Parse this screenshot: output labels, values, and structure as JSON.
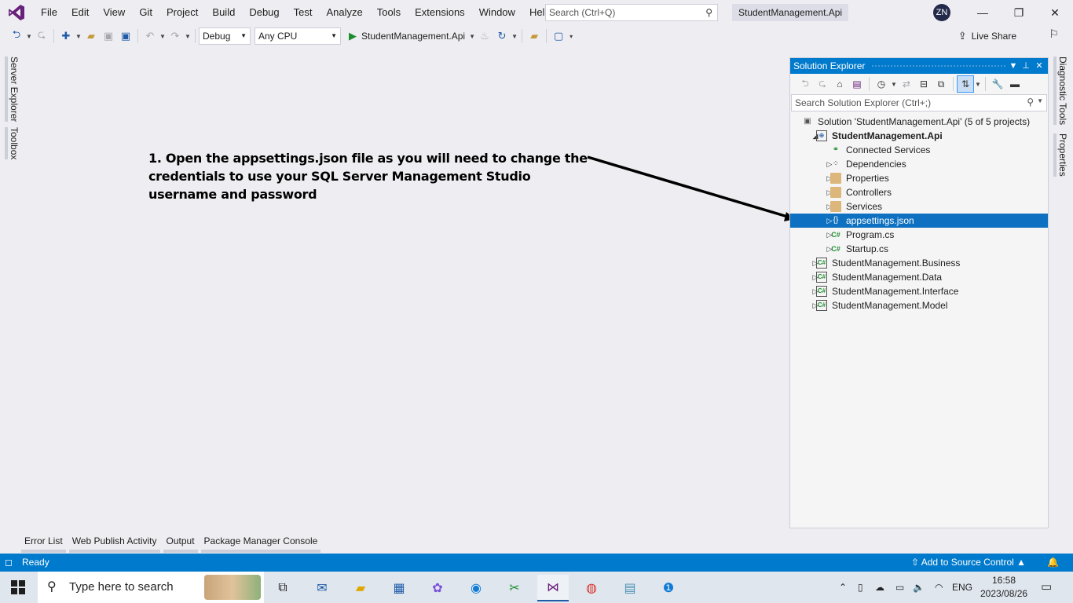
{
  "menu": {
    "items": [
      "File",
      "Edit",
      "View",
      "Git",
      "Project",
      "Build",
      "Debug",
      "Test",
      "Analyze",
      "Tools",
      "Extensions",
      "Window",
      "Help"
    ],
    "search_placeholder": "Search (Ctrl+Q)",
    "solution_title": "StudentManagement.Api",
    "avatar_initials": "ZN"
  },
  "toolbar": {
    "configuration": "Debug",
    "platform": "Any CPU",
    "startup_project": "StudentManagement.Api",
    "live_share": "Live Share"
  },
  "left_tabs": [
    "Server Explorer",
    "Toolbox"
  ],
  "right_tabs": [
    "Diagnostic Tools",
    "Properties"
  ],
  "instruction_text": "1. Open the appsettings.json file as you will need to change the credentials to use your SQL Server Management Studio username and password",
  "solution_explorer": {
    "title": "Solution Explorer",
    "search_placeholder": "Search Solution Explorer (Ctrl+;)",
    "items": [
      {
        "label": "Solution 'StudentManagement.Api' (5 of 5 projects)",
        "level": 0,
        "icon": "solution-icon",
        "expander": "none"
      },
      {
        "label": "StudentManagement.Api",
        "level": 1,
        "icon": "web-project-icon",
        "expander": "expanded",
        "bold": true
      },
      {
        "label": "Connected Services",
        "level": 2,
        "icon": "connected-services-icon",
        "expander": "none"
      },
      {
        "label": "Dependencies",
        "level": 2,
        "icon": "dependencies-icon",
        "expander": "collapsed"
      },
      {
        "label": "Properties",
        "level": 2,
        "icon": "properties-folder-icon",
        "expander": "collapsed"
      },
      {
        "label": "Controllers",
        "level": 2,
        "icon": "folder-icon",
        "expander": "collapsed"
      },
      {
        "label": "Services",
        "level": 2,
        "icon": "folder-icon",
        "expander": "collapsed"
      },
      {
        "label": "appsettings.json",
        "level": 2,
        "icon": "json-file-icon",
        "expander": "collapsed",
        "selected": true
      },
      {
        "label": "Program.cs",
        "level": 2,
        "icon": "csharp-file-icon",
        "expander": "collapsed"
      },
      {
        "label": "Startup.cs",
        "level": 2,
        "icon": "csharp-file-icon",
        "expander": "collapsed"
      },
      {
        "label": "StudentManagement.Business",
        "level": 1,
        "icon": "csharp-project-icon",
        "expander": "collapsed"
      },
      {
        "label": "StudentManagement.Data",
        "level": 1,
        "icon": "csharp-project-icon",
        "expander": "collapsed"
      },
      {
        "label": "StudentManagement.Interface",
        "level": 1,
        "icon": "csharp-project-icon",
        "expander": "collapsed"
      },
      {
        "label": "StudentManagement.Model",
        "level": 1,
        "icon": "csharp-project-icon",
        "expander": "collapsed"
      }
    ]
  },
  "bottom_tabs": [
    "Error List",
    "Web Publish Activity",
    "Output",
    "Package Manager Console"
  ],
  "statusbar": {
    "status": "Ready",
    "source_control": "Add to Source Control"
  },
  "taskbar": {
    "search_placeholder": "Type here to search",
    "language": "ENG",
    "time": "16:58",
    "date": "2023/08/26"
  },
  "colors": {
    "accent": "#007acc",
    "selection": "#0e70c0",
    "background": "#eeeef2"
  }
}
